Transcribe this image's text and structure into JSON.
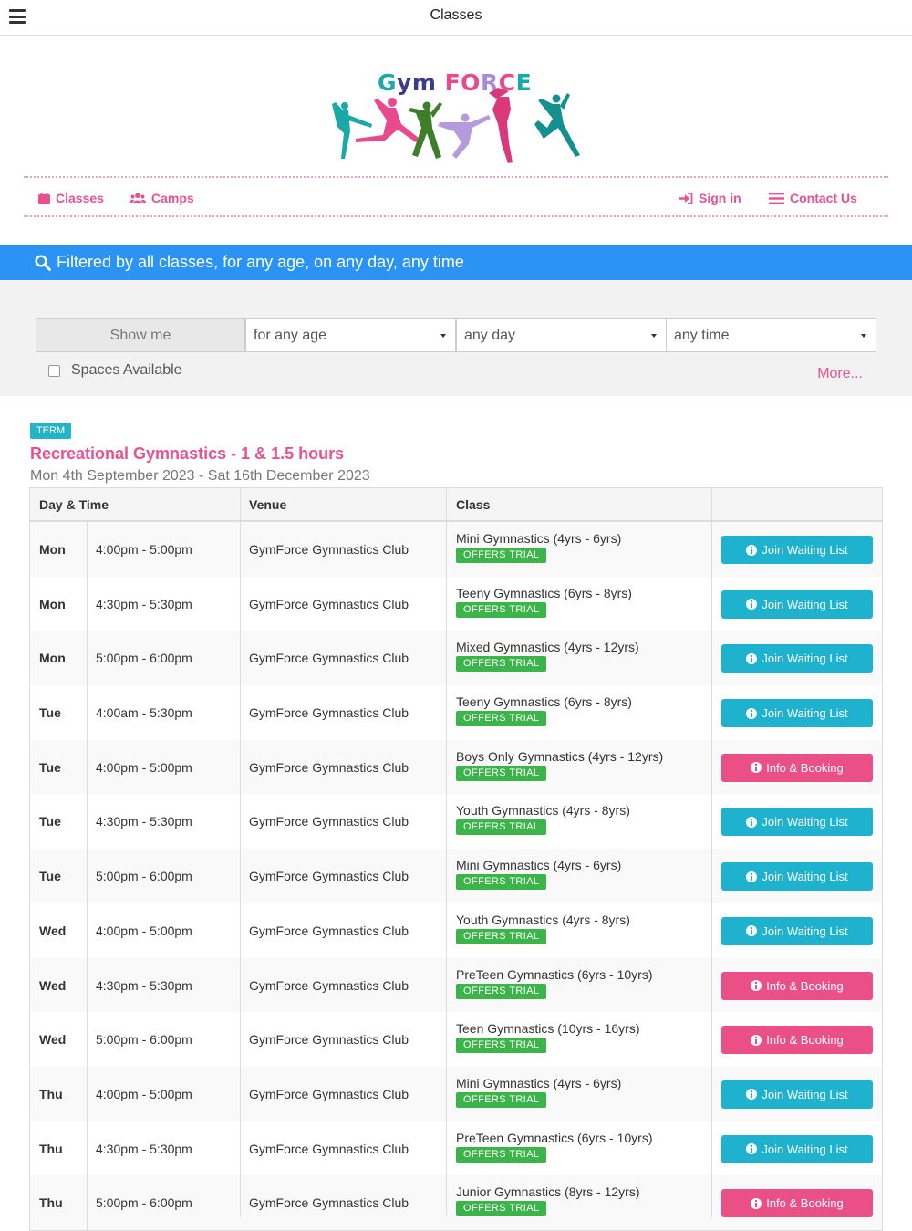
{
  "appbar": {
    "title": "Classes",
    "menu_icon": "hamburger-icon"
  },
  "logo": {
    "brand_parts": [
      {
        "text": "G",
        "color": "#1aa8a8"
      },
      {
        "text": "ym ",
        "color": "#3b3b8a"
      },
      {
        "text": "F",
        "color": "#e94a8e"
      },
      {
        "text": "O",
        "color": "#e94a8e"
      },
      {
        "text": "R",
        "color": "#a98ad6"
      },
      {
        "text": "C",
        "color": "#e94a8e"
      },
      {
        "text": "E",
        "color": "#1aa8a8"
      }
    ]
  },
  "nav": {
    "classes": "Classes",
    "camps": "Camps",
    "sign_in": "Sign in",
    "contact": "Contact Us"
  },
  "banner": {
    "text": "Filtered by all classes, for any age, on any day, any time"
  },
  "filters": {
    "show_me": "Show me",
    "age": "for any age",
    "day": "any day",
    "time": "any time",
    "spaces_available": "Spaces Available",
    "more": "More..."
  },
  "term": {
    "badge": "TERM",
    "title": "Recreational Gymnastics - 1 & 1.5 hours",
    "dates": "Mon 4th September 2023 - Sat 16th December 2023"
  },
  "table": {
    "headers": {
      "day_time": "Day & Time",
      "venue": "Venue",
      "class": "Class"
    },
    "trial_label": "OFFERS TRIAL",
    "rows": [
      {
        "day": "Mon",
        "time": "4:00pm - 5:00pm",
        "venue": "GymForce Gymnastics Club",
        "class": "Mini Gymnastics (4yrs - 6yrs)",
        "action": "Join Waiting List",
        "kind": "wait"
      },
      {
        "day": "Mon",
        "time": "4:30pm - 5:30pm",
        "venue": "GymForce Gymnastics Club",
        "class": "Teeny Gymnastics (6yrs - 8yrs)",
        "action": "Join Waiting List",
        "kind": "wait"
      },
      {
        "day": "Mon",
        "time": "5:00pm - 6:00pm",
        "venue": "GymForce Gymnastics Club",
        "class": "Mixed Gymnastics (4yrs - 12yrs)",
        "action": "Join Waiting List",
        "kind": "wait"
      },
      {
        "day": "Tue",
        "time": "4:00am - 5:30pm",
        "venue": "GymForce Gymnastics Club",
        "class": "Teeny Gymnastics (6yrs - 8yrs)",
        "action": "Join Waiting List",
        "kind": "wait"
      },
      {
        "day": "Tue",
        "time": "4:00pm - 5:00pm",
        "venue": "GymForce Gymnastics Club",
        "class": "Boys Only Gymnastics (4yrs - 12yrs)",
        "action": "Info & Booking",
        "kind": "book"
      },
      {
        "day": "Tue",
        "time": "4:30pm - 5:30pm",
        "venue": "GymForce Gymnastics Club",
        "class": "Youth Gymnastics (4yrs - 8yrs)",
        "action": "Join Waiting List",
        "kind": "wait"
      },
      {
        "day": "Tue",
        "time": "5:00pm - 6:00pm",
        "venue": "GymForce Gymnastics Club",
        "class": "Mini Gymnastics (4yrs - 6yrs)",
        "action": "Join Waiting List",
        "kind": "wait"
      },
      {
        "day": "Wed",
        "time": "4:00pm - 5:00pm",
        "venue": "GymForce Gymnastics Club",
        "class": "Youth Gymnastics (4yrs - 8yrs)",
        "action": "Join Waiting List",
        "kind": "wait"
      },
      {
        "day": "Wed",
        "time": "4:30pm - 5:30pm",
        "venue": "GymForce Gymnastics Club",
        "class": "PreTeen Gymnastics (6yrs - 10yrs)",
        "action": "Info & Booking",
        "kind": "book"
      },
      {
        "day": "Wed",
        "time": "5:00pm - 6:00pm",
        "venue": "GymForce Gymnastics Club",
        "class": "Teen Gymnastics (10yrs - 16yrs)",
        "action": "Info & Booking",
        "kind": "book"
      },
      {
        "day": "Thu",
        "time": "4:00pm - 5:00pm",
        "venue": "GymForce Gymnastics Club",
        "class": "Mini Gymnastics (4yrs - 6yrs)",
        "action": "Join Waiting List",
        "kind": "wait"
      },
      {
        "day": "Thu",
        "time": "4:30pm - 5:30pm",
        "venue": "GymForce Gymnastics Club",
        "class": "PreTeen Gymnastics (6yrs - 10yrs)",
        "action": "Join Waiting List",
        "kind": "wait"
      },
      {
        "day": "Thu",
        "time": "5:00pm - 6:00pm",
        "venue": "GymForce Gymnastics Club",
        "class": "Junior Gymnastics (8yrs - 12yrs)",
        "action": "Info & Booking",
        "kind": "book"
      }
    ]
  },
  "colors": {
    "accent": "#e9528e",
    "banner": "#2b93f4",
    "wait_button": "#1eb2ce",
    "book_button": "#ea4f86",
    "trial_badge": "#3bb44a",
    "term_badge": "#23b5c7"
  }
}
